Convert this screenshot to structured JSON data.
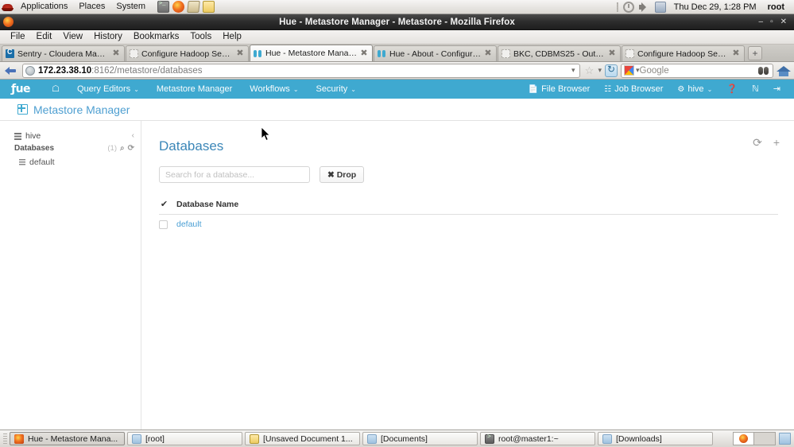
{
  "desktop_panel": {
    "menus": [
      "Applications",
      "Places",
      "System"
    ],
    "launchers": [
      "terminal-icon",
      "firefox-icon",
      "help-icon",
      "text-editor-icon"
    ],
    "tray_icons": [
      "power-icon",
      "volume-icon",
      "network-icon"
    ],
    "clock": "Thu Dec 29,  1:28 PM",
    "user": "root"
  },
  "window": {
    "title": "Hue - Metastore Manager - Metastore - Mozilla Firefox",
    "minimize": "–",
    "maximize": "▫",
    "close": "✕"
  },
  "menubar": {
    "items": [
      "File",
      "Edit",
      "View",
      "History",
      "Bookmarks",
      "Tools",
      "Help"
    ]
  },
  "tabs": [
    {
      "label": "Sentry - Cloudera Mana...",
      "favicon": "cloudera-icon",
      "active": false
    },
    {
      "label": "Configure Hadoop Secur...",
      "favicon": "blank-page-icon",
      "active": false
    },
    {
      "label": "Hue - Metastore Manag...",
      "favicon": "hue-icon",
      "active": true
    },
    {
      "label": "Hue - About - Configurat...",
      "favicon": "hue-icon",
      "active": false
    },
    {
      "label": "BKC, CDBMS25 - Outloo...",
      "favicon": "blank-page-icon",
      "active": false
    },
    {
      "label": "Configure Hadoop Secur...",
      "favicon": "blank-page-icon",
      "active": false
    }
  ],
  "new_tab_label": "+",
  "navbar": {
    "back_icon": "back-arrow-icon",
    "url_host": "172.23.38.10",
    "url_rest": ":8162/metastore/databases",
    "url_dropdown": "▾",
    "star_icon": "☆",
    "reload_icon": "reload-icon",
    "search_engine": "Google",
    "search_value": "",
    "binoculars_icon": "binoculars-icon",
    "home_icon": "home-icon"
  },
  "hue_nav": {
    "logo": "ƒue",
    "home_icon": "home-icon",
    "items": [
      {
        "label": "Query Editors",
        "caret": "⌄"
      },
      {
        "label": "Metastore Manager",
        "caret": ""
      },
      {
        "label": "Workflows",
        "caret": "⌄"
      },
      {
        "label": "Security",
        "caret": "⌄"
      }
    ],
    "right_items": [
      {
        "icon": "file-icon",
        "label": "File Browser"
      },
      {
        "icon": "list-icon",
        "label": "Job Browser"
      },
      {
        "icon": "gear-icon",
        "label": "hive",
        "caret": "⌄"
      },
      {
        "icon": "help-icon",
        "label": ""
      },
      {
        "icon": "language-icon",
        "label": ""
      },
      {
        "icon": "logout-icon",
        "label": ""
      }
    ]
  },
  "page": {
    "title": "Metastore Manager",
    "title_icon": "grid-icon"
  },
  "sidebar": {
    "source": "hive",
    "source_icon": "database-icon",
    "collapse_icon": "‹",
    "section_label": "Databases",
    "count": "(1)",
    "search_icon": "⌕",
    "refresh_icon": "⟳",
    "items": [
      {
        "label": "default",
        "icon": "database-icon"
      }
    ]
  },
  "main": {
    "heading": "Databases",
    "refresh_icon": "⟳",
    "add_icon": "+",
    "search_placeholder": "Search for a database...",
    "search_value": "",
    "drop_button": "✖ Drop",
    "select_all_check": "✔",
    "columns": [
      "Database Name"
    ],
    "rows": [
      {
        "name": "default",
        "selected": false
      }
    ]
  },
  "taskbar": {
    "tasks": [
      {
        "label": "Hue - Metastore Mana...",
        "icon": "firefox-icon",
        "active": true
      },
      {
        "label": "[root]",
        "icon": "folder-icon",
        "active": false
      },
      {
        "label": "[Unsaved Document 1...",
        "icon": "document-icon",
        "active": false
      },
      {
        "label": "[Documents]",
        "icon": "folder-icon",
        "active": false
      },
      {
        "label": "root@master1:~",
        "icon": "terminal-icon",
        "active": false
      },
      {
        "label": "[Downloads]",
        "icon": "folder-icon",
        "active": false
      }
    ],
    "workspaces": [
      {
        "active": true,
        "has_window": true
      },
      {
        "active": false,
        "has_window": false
      }
    ],
    "trash_icon": "trash-icon"
  },
  "colors": {
    "hue_blue": "#3fa9d0",
    "link_blue": "#4a9fd4",
    "heading_blue": "#3c87b8"
  }
}
